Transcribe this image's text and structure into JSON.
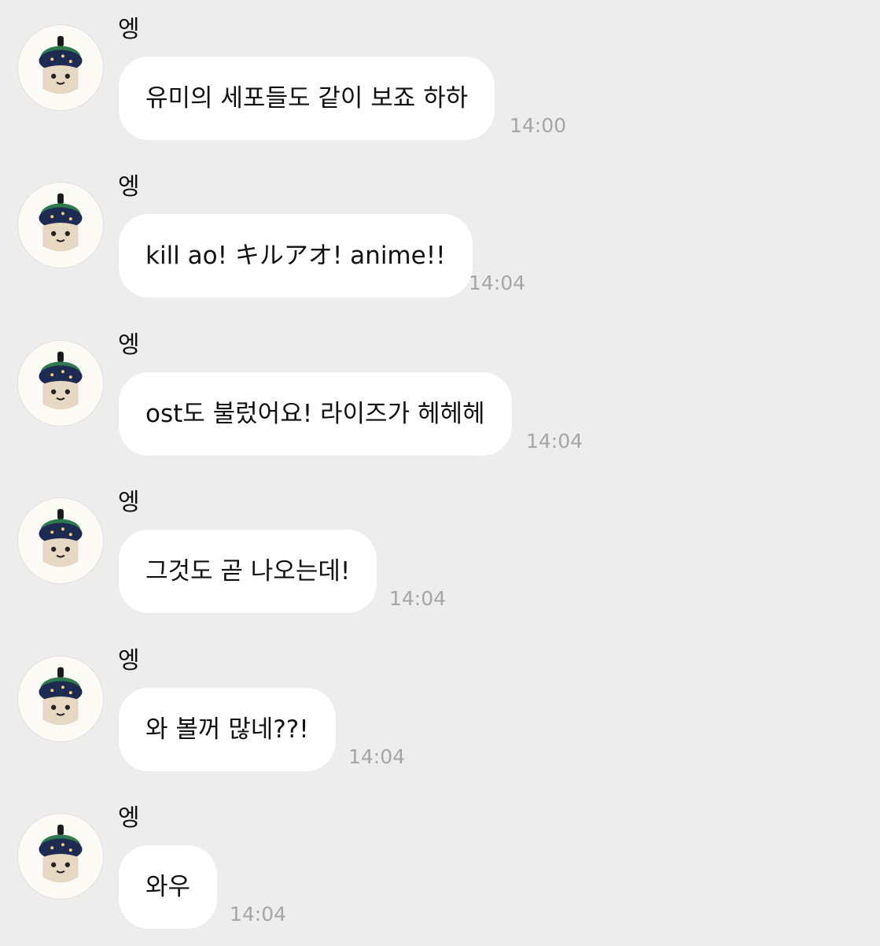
{
  "colors": {
    "background": "#ededed",
    "bubble": "#ffffff",
    "timestamp": "#a5a5a5",
    "text": "#111111"
  },
  "avatar_icon": "plush-doll-with-starry-hat",
  "messages": [
    {
      "sender": "엥",
      "text": "유미의 세포들도 같이 보죠 하하",
      "time": "14:00"
    },
    {
      "sender": "엥",
      "text": "kill ao! キルアオ! anime!!",
      "time": "14:04"
    },
    {
      "sender": "엥",
      "text": "ost도 불렀어요! 라이즈가 헤헤헤",
      "time": "14:04"
    },
    {
      "sender": "엥",
      "text": "그것도 곧 나오는데!",
      "time": "14:04"
    },
    {
      "sender": "엥",
      "text": "와 볼꺼 많네??!",
      "time": "14:04"
    },
    {
      "sender": "엥",
      "text": "와우",
      "time": "14:04"
    }
  ]
}
